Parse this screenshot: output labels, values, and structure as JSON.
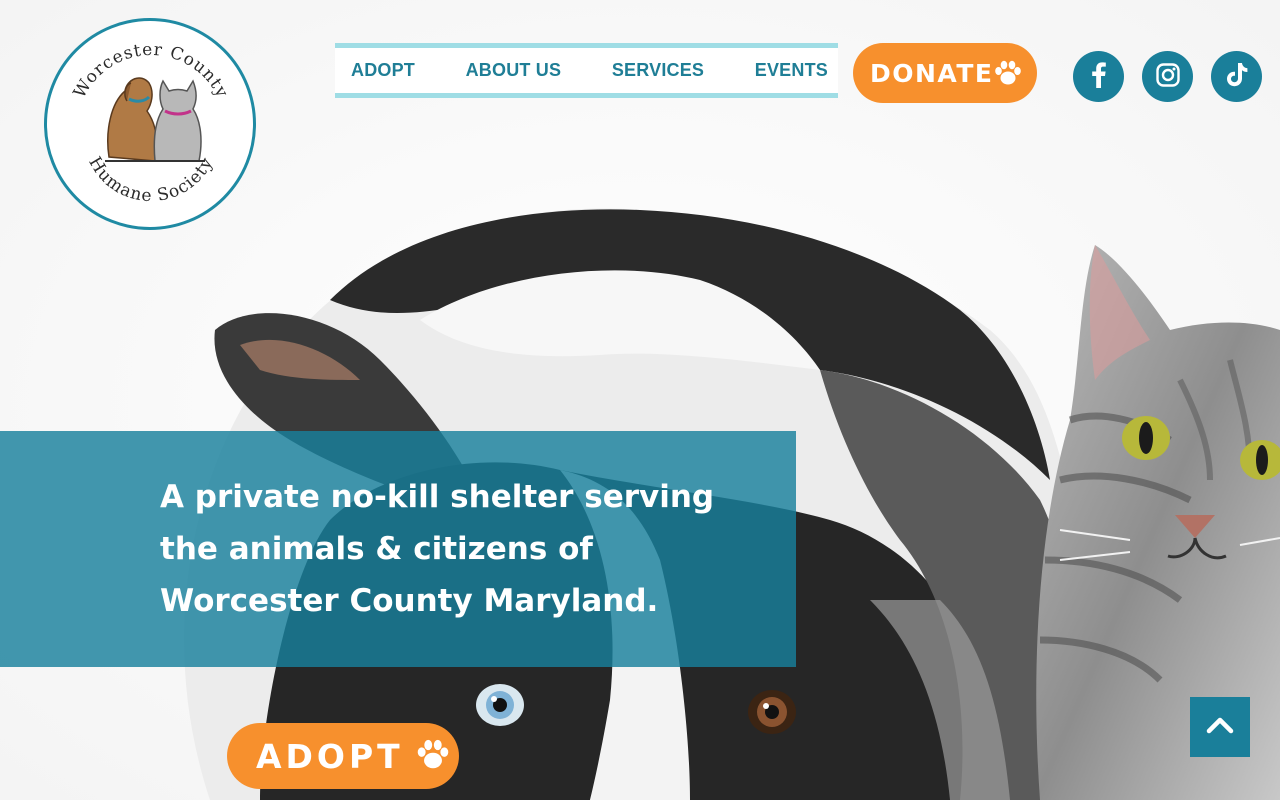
{
  "logo": {
    "top_text": "Worcester County",
    "bottom_text": "Humane Society"
  },
  "nav": {
    "items": [
      {
        "label": "ADOPT"
      },
      {
        "label": "ABOUT US"
      },
      {
        "label": "SERVICES"
      },
      {
        "label": "EVENTS"
      }
    ]
  },
  "donate": {
    "label": "DONATE",
    "icon": "paw-icon"
  },
  "social": [
    {
      "name": "facebook",
      "icon": "facebook-icon"
    },
    {
      "name": "instagram",
      "icon": "instagram-icon"
    },
    {
      "name": "tiktok",
      "icon": "tiktok-icon"
    }
  ],
  "hero": {
    "tagline": "A private no-kill shelter serving the animals & citizens of Worcester County Maryland."
  },
  "cta": {
    "adopt_label": "ADOPT",
    "icon": "paw-icon"
  },
  "back_to_top": {
    "icon": "chevron-up-icon"
  },
  "colors": {
    "primary_teal": "#1a7f9a",
    "nav_border": "#9fdde5",
    "accent_orange": "#f7902d",
    "band_overlay": "#18809c"
  }
}
